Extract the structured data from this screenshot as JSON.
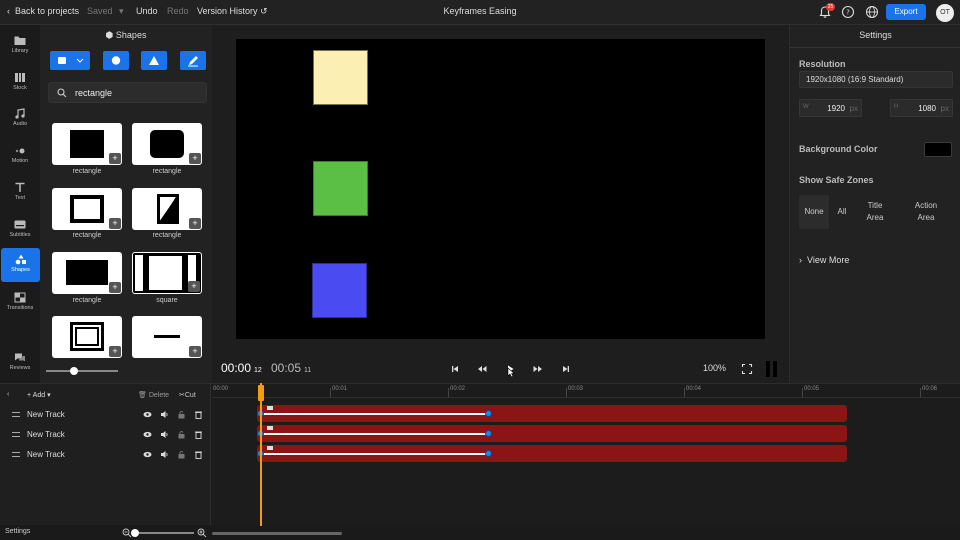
{
  "topbar": {
    "back_label": "Back to projects",
    "saved_label": "Saved",
    "undo_label": "Undo",
    "redo_label": "Redo",
    "version_history_label": "Version History",
    "title": "Keyframes Easing",
    "notification_count": "25",
    "export_label": "Export",
    "avatar_initials": "OT"
  },
  "rail": {
    "items": [
      {
        "label": "Library",
        "icon": "folder-icon"
      },
      {
        "label": "Stock",
        "icon": "stock-icon"
      },
      {
        "label": "Audio",
        "icon": "music-note-icon"
      },
      {
        "label": "Motion",
        "icon": "motion-icon"
      },
      {
        "label": "Text",
        "icon": "text-icon"
      },
      {
        "label": "Subtitles",
        "icon": "subtitles-icon"
      },
      {
        "label": "Shapes",
        "icon": "shapes-icon"
      },
      {
        "label": "Transitions",
        "icon": "transitions-icon"
      },
      {
        "label": "Reviews",
        "icon": "chat-icon"
      }
    ]
  },
  "shapes_panel": {
    "title": "Shapes",
    "search_value": "rectangle",
    "tiles": [
      {
        "label": "rectangle"
      },
      {
        "label": "rectangle"
      },
      {
        "label": "rectangle"
      },
      {
        "label": "rectangle"
      },
      {
        "label": "rectangle"
      },
      {
        "label": "square"
      },
      {
        "label": ""
      },
      {
        "label": ""
      }
    ],
    "add_glyph": "+"
  },
  "preview": {
    "current_time": "00:00",
    "current_frames": "12",
    "duration": "00:05",
    "duration_frames": "11",
    "zoom": "100%",
    "squares": [
      {
        "color": "#fbefb3"
      },
      {
        "color": "#5bbf45"
      },
      {
        "color": "#4b4bf2"
      }
    ]
  },
  "settings": {
    "title": "Settings",
    "resolution_label": "Resolution",
    "resolution_value": "1920x1080 (16:9 Standard)",
    "width_label": "W",
    "width_value": "1920",
    "height_label": "H",
    "height_value": "1080",
    "unit": "px",
    "background_color_label": "Background Color",
    "background_color": "#000000",
    "safe_zones_label": "Show Safe Zones",
    "zones": [
      "None",
      "All",
      "Title Area",
      "Action Area"
    ],
    "view_more_label": "View More"
  },
  "timeline": {
    "add_label": "Add",
    "delete_label": "Delete",
    "cut_label": "Cut",
    "ruler": [
      "00:00",
      "00:01",
      "00:02",
      "00:03",
      "00:04",
      "00:05",
      "00:06"
    ],
    "tracks": [
      {
        "name": "New Track"
      },
      {
        "name": "New Track"
      },
      {
        "name": "New Track"
      }
    ],
    "clip_color": "#8b1414",
    "settings_label": "Settings"
  }
}
